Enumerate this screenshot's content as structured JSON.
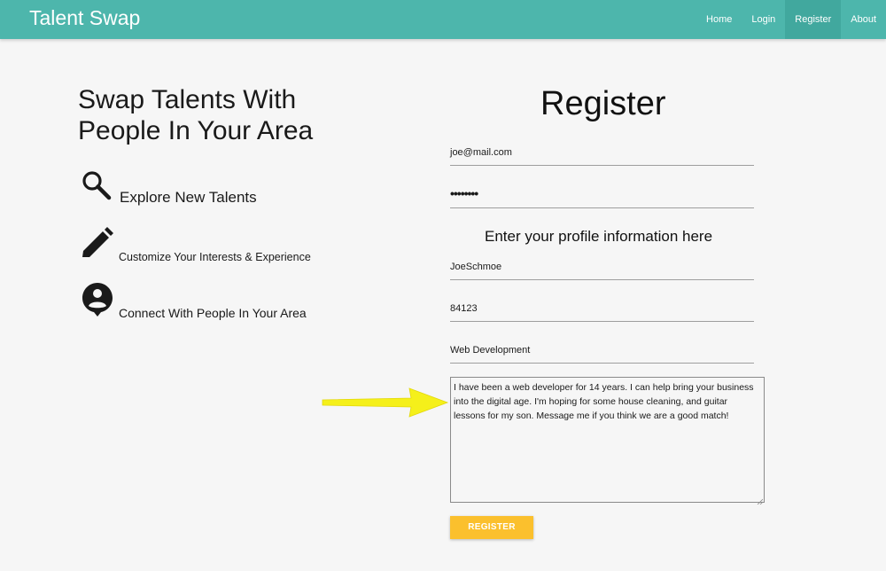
{
  "navbar": {
    "brand": "Talent Swap",
    "links": [
      "Home",
      "Login",
      "Register",
      "About"
    ],
    "active": "Register",
    "color": "#4db6ac"
  },
  "hero": {
    "tagline": "Swap Talents With People In Your Area",
    "features": [
      {
        "icon": "search-icon",
        "label": "Explore New Talents"
      },
      {
        "icon": "pencil-icon",
        "label": "Customize Your Interests & Experience"
      },
      {
        "icon": "person-pin-icon",
        "label": "Connect With People In Your Area"
      }
    ]
  },
  "form": {
    "title": "Register",
    "email_value": "joe@mail.com",
    "password_value": "••••••••",
    "profile_heading": "Enter your profile information here",
    "username_value": "JoeSchmoe",
    "zip_value": "84123",
    "talent_value": "Web Development",
    "bio_value": "I have been a web developer for 14 years. I can help bring your business into the digital age. I'm hoping for some house cleaning, and guitar lessons for my son. Message me if you think we are a good match!",
    "submit_label": "REGISTER",
    "submit_color": "#fbc02d"
  },
  "annotation": {
    "icon": "yellow-arrow-icon",
    "color": "#f5f01a"
  }
}
